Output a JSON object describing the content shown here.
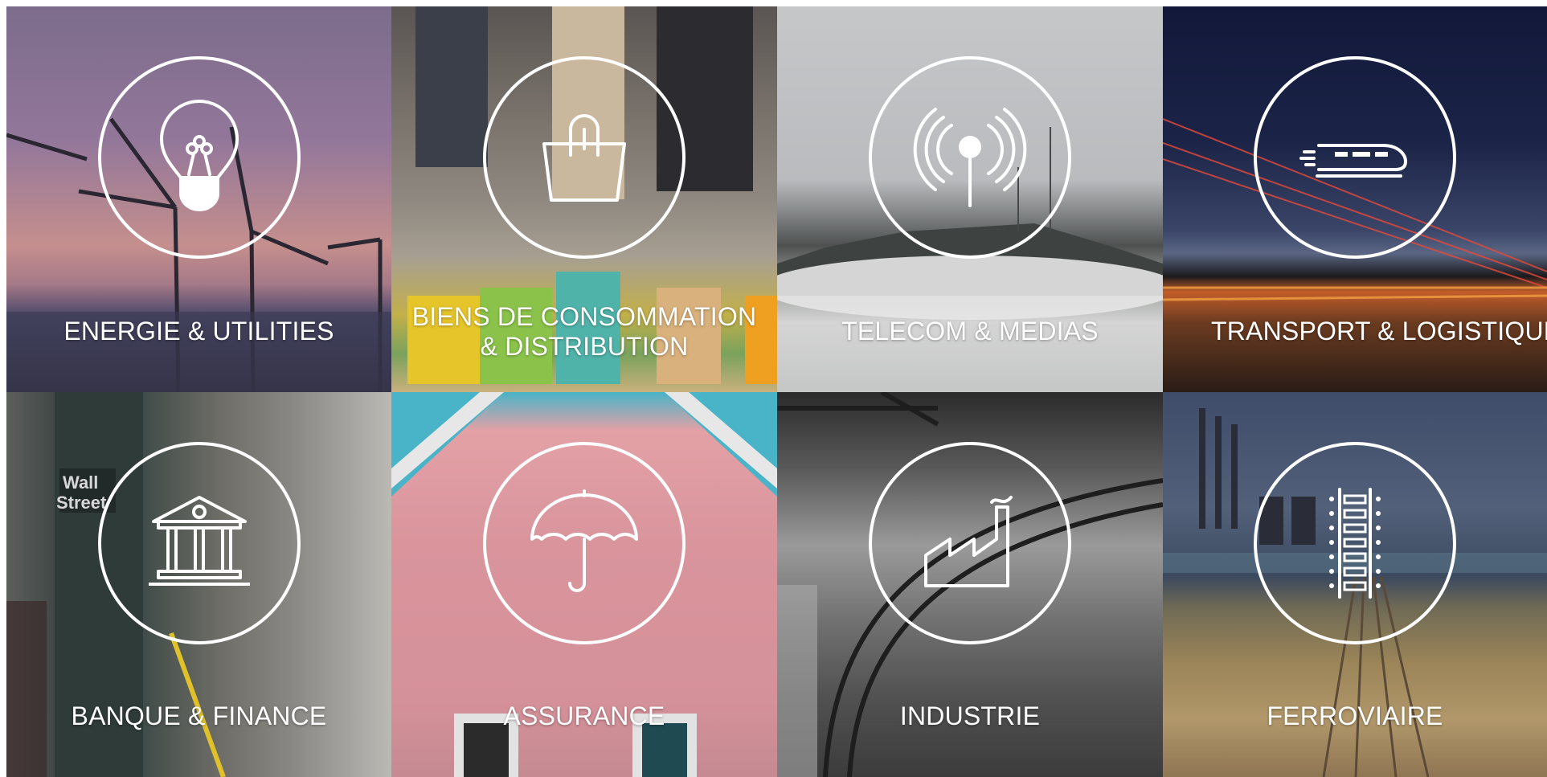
{
  "tiles": [
    {
      "label": "ENERGIE & UTILITIES",
      "icon": "lightbulb-icon"
    },
    {
      "label": "BIENS DE CONSOMMATION\n& DISTRIBUTION",
      "icon": "shopping-bag-icon"
    },
    {
      "label": "TELECOM & MEDIAS",
      "icon": "antenna-icon"
    },
    {
      "label": "TRANSPORT & LOGISTIQUE",
      "icon": "train-icon"
    },
    {
      "label": "BANQUE & FINANCE",
      "icon": "bank-icon"
    },
    {
      "label": "ASSURANCE",
      "icon": "umbrella-icon"
    },
    {
      "label": "INDUSTRIE",
      "icon": "factory-icon"
    },
    {
      "label": "FERROVIAIRE",
      "icon": "railway-track-icon"
    }
  ],
  "colors": {
    "ring": "#ffffff",
    "text": "#ffffff"
  }
}
